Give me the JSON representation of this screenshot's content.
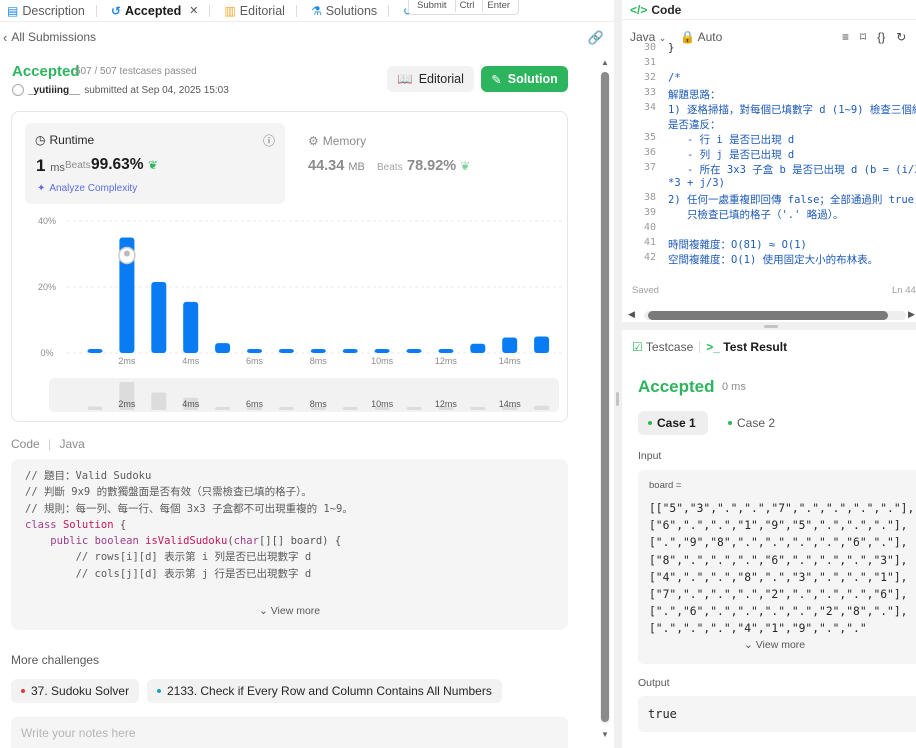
{
  "left_tabs": [
    {
      "label": "Description",
      "icon": "description-icon"
    },
    {
      "label": "Accepted",
      "icon": "history-icon"
    },
    {
      "label": "Editorial",
      "icon": "editorial-icon"
    },
    {
      "label": "Solutions",
      "icon": "flask-icon"
    },
    {
      "label": "Submissions",
      "icon": "history-icon"
    }
  ],
  "tab_close": "✕",
  "shortcut_tooltip": {
    "submit": "Submit",
    "ctrl": "Ctrl",
    "enter": "Enter"
  },
  "all_submissions": "All Submissions",
  "submission": {
    "status": "Accepted",
    "testcases": "507 / 507 testcases passed",
    "author": "_yutiiing__",
    "submitted_text": "submitted at Sep 04, 2025 15:03"
  },
  "buttons": {
    "editorial": "Editorial",
    "solution": "Solution"
  },
  "runtime": {
    "title": "Runtime",
    "value": "1",
    "unit": "ms",
    "beats_label": "Beats",
    "beats_pct": "99.63%",
    "analyze": "Analyze Complexity"
  },
  "memory": {
    "title": "Memory",
    "value": "44.34",
    "unit": "MB",
    "beats_label": "Beats",
    "beats_pct": "78.92%"
  },
  "chart_data": {
    "type": "bar",
    "title": "",
    "xlabel": "",
    "ylabel": "",
    "ylim": [
      0,
      40
    ],
    "y_ticks": [
      "40%",
      "20%",
      "0%"
    ],
    "x_ticks": [
      "2ms",
      "4ms",
      "6ms",
      "8ms",
      "10ms",
      "12ms",
      "14ms"
    ],
    "values": [
      1.2,
      35.0,
      21.5,
      15.5,
      3.0,
      1.2,
      1.2,
      1.2,
      1.2,
      1.2,
      1.2,
      1.2,
      2.8,
      4.7,
      5.0
    ],
    "highlight_index": 1,
    "minimap_values": [
      1,
      8,
      5,
      3.5,
      0.8,
      0.8,
      0.8,
      0.8,
      0.8,
      0.8,
      0.8,
      0.8,
      0.8,
      1.2,
      1.2
    ],
    "color": "#0a7cf3"
  },
  "code_section": {
    "label": "Code",
    "language": "Java",
    "lines": [
      "// 題目：Valid Sudoku",
      "// 判斷 9x9 的數獨盤面是否有效（只需檢查已填的格子）。",
      "// 規則：每一列、每一行、每個 3x3 子盒都不可出現重複的 1~9。",
      "",
      "class Solution {",
      "    public boolean isValidSudoku(char[][] board) {",
      "        // rows[i][d] 表示第 i 列是否已出現數字 d",
      "        // cols[j][d] 表示第 j 行是否已出現數字 d"
    ],
    "view_more": "View more"
  },
  "more_challenges": {
    "title": "More challenges",
    "items": [
      {
        "label": "37. Sudoku Solver",
        "dot": "#e53935"
      },
      {
        "label": "2133. Check if Every Row and Column Contains All Numbers",
        "dot": "#1aa3b8"
      }
    ]
  },
  "notes_placeholder": "Write your notes here",
  "editor": {
    "title": "Code",
    "language": "Java",
    "mode": "Auto",
    "lines": [
      {
        "n": "30",
        "t": "}"
      },
      {
        "n": "31",
        "t": ""
      },
      {
        "n": "32",
        "t": "/*"
      },
      {
        "n": "33",
        "t": "解題思路："
      },
      {
        "n": "34",
        "t": "1) 逐格掃描，對每個已填數字 d (1~9) 檢查三個維度"
      },
      {
        "n": "",
        "t": "是否違反："
      },
      {
        "n": "35",
        "t": "   - 行 i 是否已出現 d"
      },
      {
        "n": "36",
        "t": "   - 列 j 是否已出現 d"
      },
      {
        "n": "37",
        "t": "   - 所在 3x3 子盒 b 是否已出現 d (b = (i/3)"
      },
      {
        "n": "",
        "t": "*3 + j/3)"
      },
      {
        "n": "38",
        "t": "2) 任何一處重複即回傳 false；全部通過則 true"
      },
      {
        "n": "39",
        "t": "   只檢查已填的格子（'.' 略過）。"
      },
      {
        "n": "40",
        "t": ""
      },
      {
        "n": "41",
        "t": "時間複雜度：O(81) ≈ O(1)"
      },
      {
        "n": "42",
        "t": "空間複雜度：O(1) 使用固定大小的布林表。"
      }
    ],
    "saved": "Saved",
    "position": "Ln 44"
  },
  "result": {
    "tab_testcase": "Testcase",
    "tab_result": "Test Result",
    "status": "Accepted",
    "runtime": "0 ms",
    "cases": [
      "Case 1",
      "Case 2"
    ],
    "input_label": "Input",
    "input_name": "board =",
    "input_value": "[[\"5\",\"3\",\".\",\".\",\"7\",\".\",\".\",\".\",\".\"],[\"6\",\".\",\".\",\"1\",\"9\",\"5\",\".\",\".\",\".\"],[\".\",\"9\",\"8\",\".\",\".\",\".\",\".\",\"6\",\".\"],[\"8\",\".\",\".\",\".\",\"6\",\".\",\".\",\".\",\"3\"],[\"4\",\".\",\".\",\"8\",\".\",\"3\",\".\",\".\",\"1\"],[\"7\",\".\",\".\",\".\",\"2\",\".\",\".\",\".\",\"6\"],[\".\",\"6\",\".\",\".\",\".\",\".\",\"2\",\"8\",\".\"],[\".\",\".\",\".\",\"4\",\"1\",\"9\",\".\",\".\"",
    "view_more": "View more",
    "output_label": "Output",
    "output_value": "true"
  }
}
